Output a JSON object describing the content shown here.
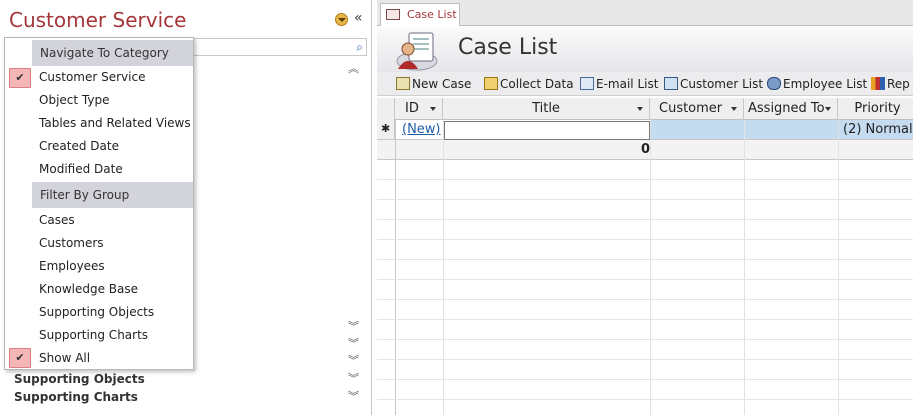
{
  "nav": {
    "title": "Customer Service",
    "collapse_glyph": "«",
    "groups_below": [
      "Supporting Objects",
      "Supporting Charts"
    ]
  },
  "dropdown": {
    "sections": [
      {
        "header": "Navigate To Category",
        "items": [
          "Customer Service",
          "Object Type",
          "Tables and Related Views",
          "Created Date",
          "Modified Date"
        ],
        "checked": "Customer Service"
      },
      {
        "header": "Filter By Group",
        "items": [
          "Cases",
          "Customers",
          "Employees",
          "Knowledge Base",
          "Supporting Objects",
          "Supporting Charts",
          "Show All"
        ],
        "checked": "Show All"
      }
    ]
  },
  "tab": {
    "label": "Case List"
  },
  "form": {
    "title": "Case List"
  },
  "toolbar": {
    "buttons": [
      "New Case",
      "Collect Data",
      "E-mail List",
      "Customer List",
      "Employee List",
      "Rep"
    ]
  },
  "datasheet": {
    "columns": [
      "ID",
      "Title",
      "Customer",
      "Assigned To",
      "Priority"
    ],
    "new_row": {
      "marker": "✱",
      "id": "(New)",
      "priority": "(2) Normal"
    },
    "total_row": {
      "title": "0"
    }
  },
  "colors": {
    "accent": "#a4373a",
    "check_bg": "#f4b6b6",
    "selected_cell": "#c5dbef"
  }
}
